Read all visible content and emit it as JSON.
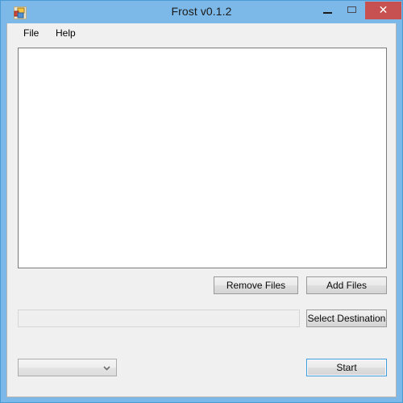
{
  "window": {
    "title": "Frost v0.1.2",
    "app_icon": "application-window-icon",
    "chrome_color": "#7db9e8",
    "close_button_color": "#c75050",
    "controls": {
      "minimize": {
        "label": "–",
        "icon": "minimize-icon"
      },
      "maximize": {
        "label": "❐",
        "icon": "maximize-icon"
      },
      "close": {
        "label": "✕",
        "icon": "close-icon"
      }
    }
  },
  "menubar": {
    "items": [
      {
        "label": "File"
      },
      {
        "label": "Help"
      }
    ]
  },
  "file_list": {
    "items": [],
    "empty": true
  },
  "buttons": {
    "remove_files": "Remove Files",
    "add_files": "Add Files",
    "select_destination": "Select Destination",
    "start": "Start"
  },
  "destination": {
    "value": "",
    "placeholder": ""
  },
  "format_select": {
    "value": "",
    "options": [],
    "arrow_icon": "chevron-down-icon"
  },
  "accent": {
    "focus_border": "#3c9ade"
  }
}
